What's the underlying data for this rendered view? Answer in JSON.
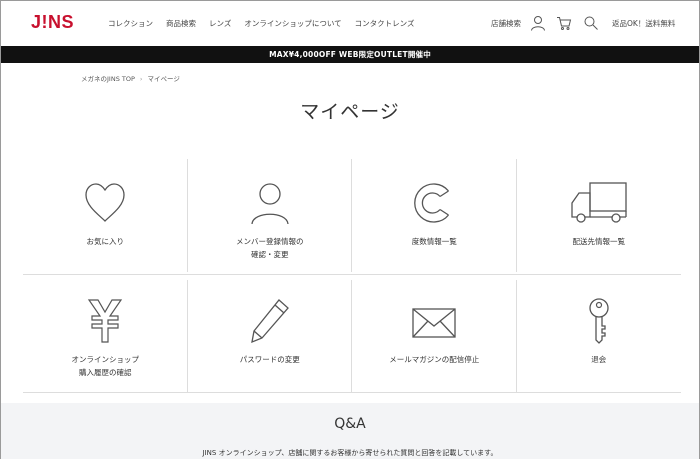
{
  "header": {
    "logo": "J!NS",
    "nav": [
      "コレクション",
      "商品検索",
      "レンズ",
      "オンラインショップについて",
      "コンタクトレンズ"
    ],
    "store_search": "店舗検索",
    "shipping_note": "返品OK！送料無料",
    "icons": [
      "user-icon",
      "cart-icon",
      "search-icon"
    ]
  },
  "banner": {
    "text": "MAX¥4,000OFF WEB限定OUTLET開催中"
  },
  "breadcrumb": {
    "home": "メガネのJINS TOP",
    "separator": "›",
    "current": "マイページ"
  },
  "page_title": "マイページ",
  "menu": [
    {
      "label": "お気に入り",
      "icon": "heart-icon"
    },
    {
      "label": "メンバー登録情報の\n確認・変更",
      "icon": "person-icon"
    },
    {
      "label": "度数情報一覧",
      "icon": "c-ring-icon"
    },
    {
      "label": "配送先情報一覧",
      "icon": "truck-icon"
    },
    {
      "label": "オンラインショップ\n購入履歴の確認",
      "icon": "yen-icon"
    },
    {
      "label": "パスワードの変更",
      "icon": "pencil-icon"
    },
    {
      "label": "メールマガジンの配信停止",
      "icon": "envelope-icon"
    },
    {
      "label": "退会",
      "icon": "key-icon"
    }
  ],
  "qa": {
    "title": "Q&A",
    "description": "JINS オンラインショップ、店舗に関するお客様から寄せられた質問と回答を記載しています。"
  },
  "colors": {
    "brand": "#c8102e",
    "banner_bg": "#111111",
    "qa_bg": "#f3f4f6",
    "icon_stroke": "#555555"
  }
}
